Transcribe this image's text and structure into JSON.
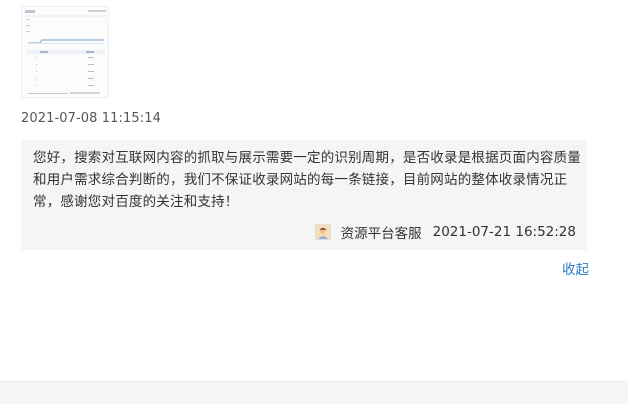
{
  "post": {
    "timestamp": "2021-07-08 11:15:14",
    "image": {
      "icon": "screenshot-thumbnail"
    }
  },
  "reply": {
    "text": "您好，搜索对互联网内容的抓取与展示需要一定的识别周期，是否收录是根据页面内容质量和用户需求综合判断的，我们不保证收录网站的每一条链接，目前网站的整体收录情况正常，感谢您对百度的关注和支持！",
    "author": "资源平台客服",
    "time": "2021-07-21 16:52:28",
    "avatar_icon": "service-avatar-icon"
  },
  "actions": {
    "collapse_label": "收起"
  },
  "colors": {
    "link": "#2f7ac8",
    "reply_bg": "#f5f5f5",
    "text": "#333333"
  }
}
